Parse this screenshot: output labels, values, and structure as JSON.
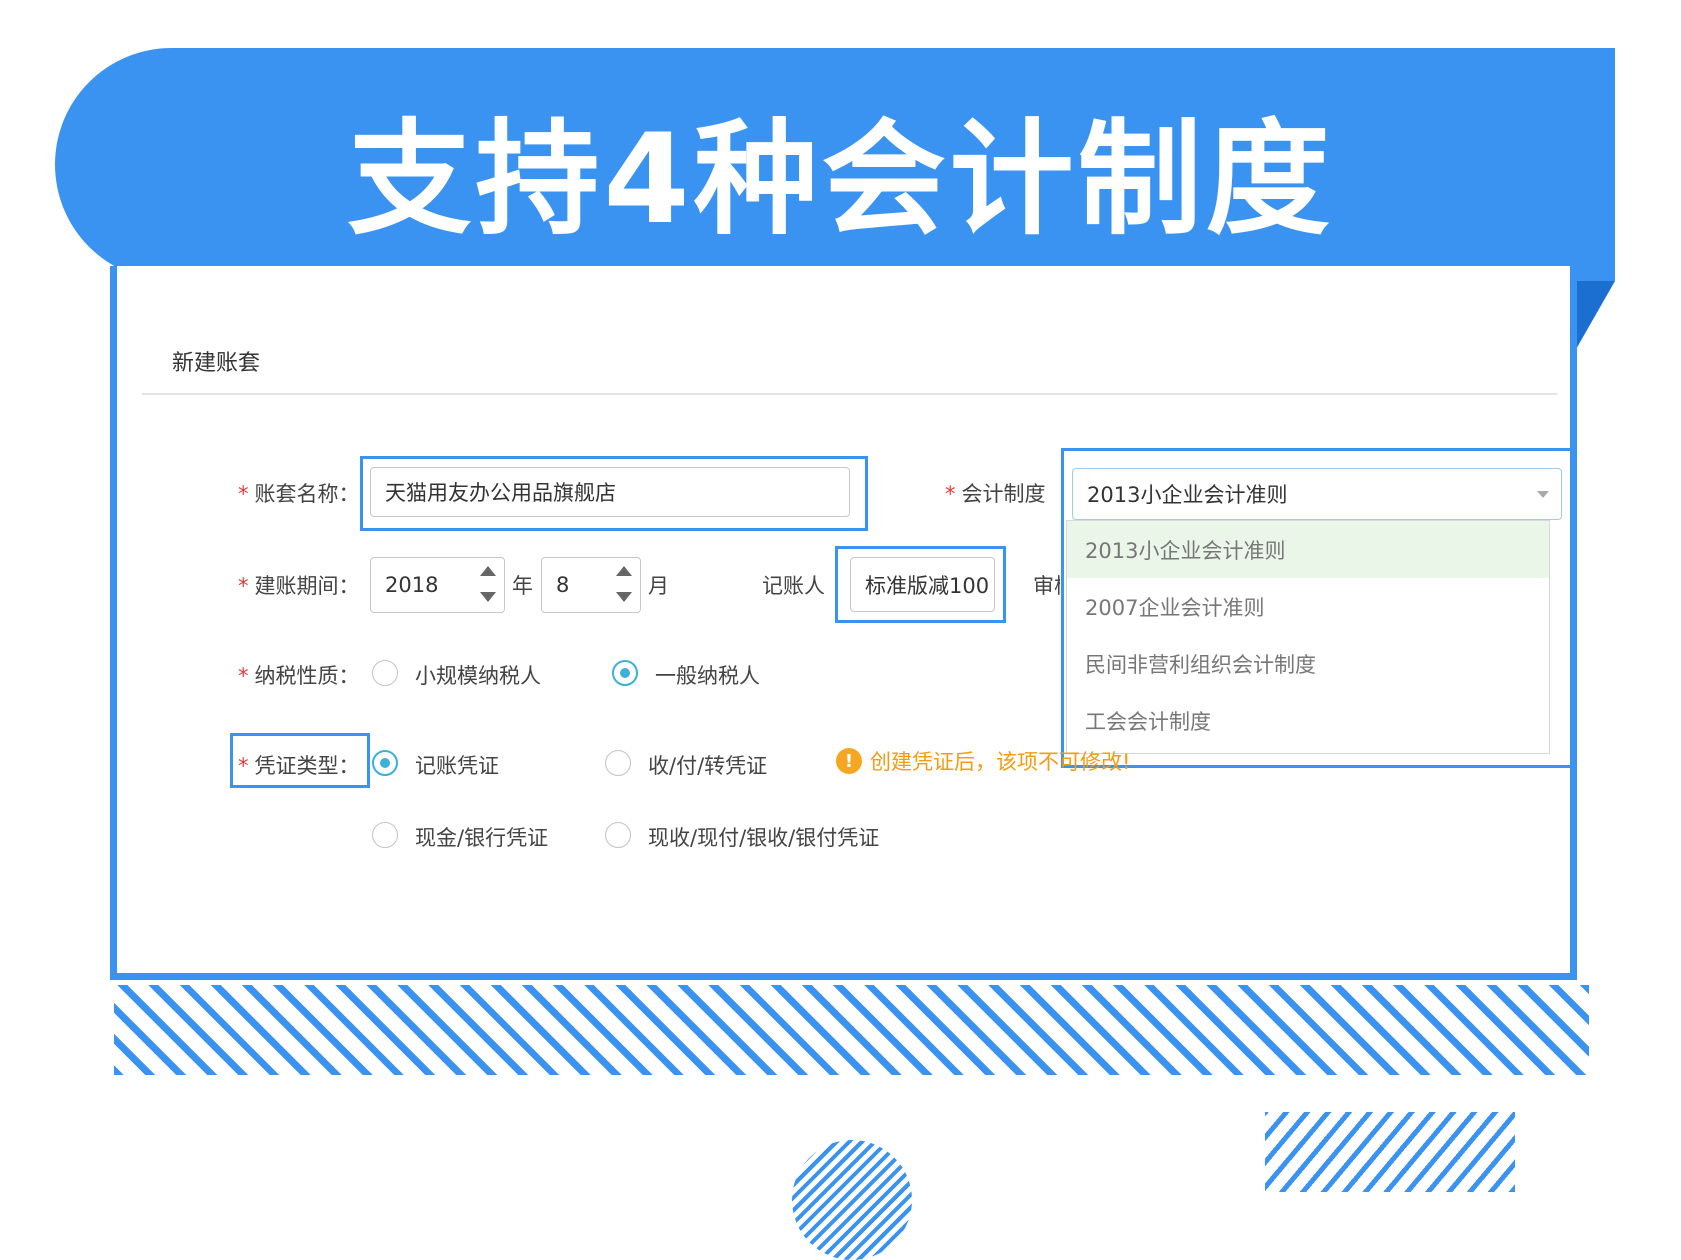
{
  "banner": {
    "title": "支持4种会计制度"
  },
  "form": {
    "header": "新建账套",
    "required_mark": "*",
    "account_name": {
      "label": "账套名称：",
      "value": "天猫用友办公用品旗舰店"
    },
    "accounting_system": {
      "label": "会计制度",
      "selected": "2013小企业会计准则",
      "options": [
        "2013小企业会计准则",
        "2007企业会计准则",
        "民间非营利组织会计制度",
        "工会会计制度"
      ]
    },
    "period": {
      "label": "建账期间：",
      "year": "2018",
      "year_unit": "年",
      "month": "8",
      "month_unit": "月"
    },
    "bookkeeper": {
      "label": "记账人",
      "value": "标准版减100"
    },
    "auditor": {
      "label": "审核"
    },
    "tax_type": {
      "label": "纳税性质：",
      "options": [
        "小规模纳税人",
        "一般纳税人"
      ],
      "selected": "一般纳税人"
    },
    "voucher_type": {
      "label": "凭证类型：",
      "options": [
        "记账凭证",
        "收/付/转凭证",
        "现金/银行凭证",
        "现收/现付/银收/银付凭证"
      ],
      "selected": "记账凭证",
      "warning_icon": "info-icon",
      "warning": "创建凭证后，该项不可修改!"
    }
  },
  "colors": {
    "accent": "#3a93f1",
    "warning": "#f39c12",
    "required": "#e23b3b",
    "radio_active": "#3bb0d8"
  }
}
